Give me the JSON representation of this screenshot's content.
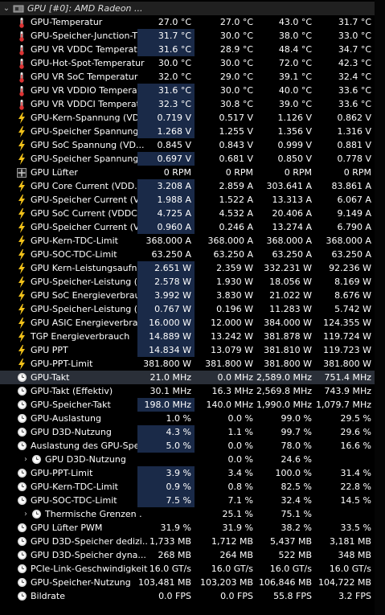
{
  "header": {
    "title": "GPU [#0]: AMD Radeon ..."
  },
  "rows": [
    {
      "icon": "thermometer-icon",
      "name": "GPU-Temperatur",
      "v": [
        "27.0 °C",
        "27.0 °C",
        "43.0 °C",
        "31.7 °C"
      ],
      "hl": false
    },
    {
      "icon": "thermometer-icon",
      "name": "GPU-Speicher-Junction-T...",
      "v": [
        "31.7 °C",
        "30.0 °C",
        "38.0 °C",
        "33.0 °C"
      ],
      "hl": true
    },
    {
      "icon": "thermometer-icon",
      "name": "GPU VR VDDC Temperatur",
      "v": [
        "31.6 °C",
        "28.9 °C",
        "48.4 °C",
        "34.7 °C"
      ],
      "hl": true
    },
    {
      "icon": "thermometer-icon",
      "name": "GPU-Hot-Spot-Temperatur",
      "v": [
        "30.0 °C",
        "30.0 °C",
        "72.0 °C",
        "42.3 °C"
      ],
      "hl": false
    },
    {
      "icon": "thermometer-icon",
      "name": "GPU VR SoC Temperatur",
      "v": [
        "32.0 °C",
        "29.0 °C",
        "39.1 °C",
        "32.4 °C"
      ],
      "hl": false
    },
    {
      "icon": "thermometer-icon",
      "name": "GPU VR VDDIO Temperatur",
      "v": [
        "31.6 °C",
        "30.0 °C",
        "40.0 °C",
        "33.6 °C"
      ],
      "hl": true
    },
    {
      "icon": "thermometer-icon",
      "name": "GPU VR VDDCI Temperatur",
      "v": [
        "32.3 °C",
        "30.8 °C",
        "39.0 °C",
        "33.6 °C"
      ],
      "hl": true
    },
    {
      "icon": "lightning-icon",
      "name": "GPU-Kern-Spannung (VD...",
      "v": [
        "0.719 V",
        "0.517 V",
        "1.126 V",
        "0.862 V"
      ],
      "hl": true
    },
    {
      "icon": "lightning-icon",
      "name": "GPU-Speicher Spannung ...",
      "v": [
        "1.268 V",
        "1.255 V",
        "1.356 V",
        "1.316 V"
      ],
      "hl": true
    },
    {
      "icon": "lightning-icon",
      "name": "GPU SoC Spannung (VD...",
      "v": [
        "0.845 V",
        "0.843 V",
        "0.999 V",
        "0.881 V"
      ],
      "hl": false
    },
    {
      "icon": "lightning-icon",
      "name": "GPU-Speicher Spannung ...",
      "v": [
        "0.697 V",
        "0.681 V",
        "0.850 V",
        "0.778 V"
      ],
      "hl": true
    },
    {
      "icon": "fan-icon",
      "name": "GPU Lüfter",
      "v": [
        "0 RPM",
        "0 RPM",
        "0 RPM",
        "0 RPM"
      ],
      "hl": false
    },
    {
      "icon": "lightning-icon",
      "name": "GPU Core Current (VDD...",
      "v": [
        "3.208 A",
        "2.859 A",
        "303.641 A",
        "83.861 A"
      ],
      "hl": true
    },
    {
      "icon": "lightning-icon",
      "name": "GPU-Speicher Current (V...",
      "v": [
        "1.988 A",
        "1.522 A",
        "13.313 A",
        "6.067 A"
      ],
      "hl": true
    },
    {
      "icon": "lightning-icon",
      "name": "GPU SoC Current (VDDC...",
      "v": [
        "4.725 A",
        "4.532 A",
        "20.406 A",
        "9.149 A"
      ],
      "hl": true
    },
    {
      "icon": "lightning-icon",
      "name": "GPU-Speicher Current (V...",
      "v": [
        "0.960 A",
        "0.246 A",
        "13.274 A",
        "6.790 A"
      ],
      "hl": true
    },
    {
      "icon": "lightning-icon",
      "name": "GPU-Kern-TDC-Limit",
      "v": [
        "368.000 A",
        "368.000 A",
        "368.000 A",
        "368.000 A"
      ],
      "hl": false
    },
    {
      "icon": "lightning-icon",
      "name": "GPU-SOC-TDC-Limit",
      "v": [
        "63.250 A",
        "63.250 A",
        "63.250 A",
        "63.250 A"
      ],
      "hl": false
    },
    {
      "icon": "lightning-icon",
      "name": "GPU Kern-Leistungsaufn...",
      "v": [
        "2.651 W",
        "2.359 W",
        "332.231 W",
        "92.236 W"
      ],
      "hl": true
    },
    {
      "icon": "lightning-icon",
      "name": "GPU-Speicher-Leistung (...",
      "v": [
        "2.578 W",
        "1.930 W",
        "18.056 W",
        "8.169 W"
      ],
      "hl": true
    },
    {
      "icon": "lightning-icon",
      "name": "GPU SoC Energieverbrau...",
      "v": [
        "3.992 W",
        "3.830 W",
        "21.022 W",
        "8.676 W"
      ],
      "hl": true
    },
    {
      "icon": "lightning-icon",
      "name": "GPU-Speicher-Leistung (...",
      "v": [
        "0.767 W",
        "0.196 W",
        "11.283 W",
        "5.742 W"
      ],
      "hl": true
    },
    {
      "icon": "lightning-icon",
      "name": "GPU ASIC Energieverbra...",
      "v": [
        "16.000 W",
        "12.000 W",
        "384.000 W",
        "124.355 W"
      ],
      "hl": true
    },
    {
      "icon": "lightning-icon",
      "name": "TGP Energieverbrauch",
      "v": [
        "14.889 W",
        "13.242 W",
        "381.878 W",
        "119.724 W"
      ],
      "hl": true
    },
    {
      "icon": "lightning-icon",
      "name": "GPU PPT",
      "v": [
        "14.834 W",
        "13.079 W",
        "381.810 W",
        "119.723 W"
      ],
      "hl": true
    },
    {
      "icon": "lightning-icon",
      "name": "GPU-PPT-Limit",
      "v": [
        "381.800 W",
        "381.800 W",
        "381.800 W",
        "381.800 W"
      ],
      "hl": false
    },
    {
      "icon": "clock-icon",
      "name": "GPU-Takt",
      "v": [
        "21.0 MHz",
        "0.0 MHz",
        "2,589.0 MHz",
        "751.4 MHz"
      ],
      "hl": false,
      "sel": true
    },
    {
      "icon": "clock-icon",
      "name": "GPU-Takt (Effektiv)",
      "v": [
        "30.1 MHz",
        "16.3 MHz",
        "2,569.8 MHz",
        "743.9 MHz"
      ],
      "hl": false
    },
    {
      "icon": "clock-icon",
      "name": "GPU-Speicher-Takt",
      "v": [
        "198.0 MHz",
        "140.0 MHz",
        "1,990.0 MHz",
        "1,079.7 MHz"
      ],
      "hl": true
    },
    {
      "icon": "clock-icon",
      "name": "GPU-Auslastung",
      "v": [
        "1.0 %",
        "0.0 %",
        "99.0 %",
        "29.5 %"
      ],
      "hl": false
    },
    {
      "icon": "clock-icon",
      "name": "GPU D3D-Nutzung",
      "v": [
        "4.3 %",
        "1.1 %",
        "99.7 %",
        "29.6 %"
      ],
      "hl": true
    },
    {
      "icon": "clock-icon",
      "name": "Auslastung des GPU-Spe...",
      "v": [
        "5.0 %",
        "0.0 %",
        "78.0 %",
        "16.6 %"
      ],
      "hl": true
    },
    {
      "icon": "clock-icon",
      "name": "GPU D3D-Nutzung",
      "v": [
        "",
        "0.0 %",
        "24.6 %",
        ""
      ],
      "hl": false,
      "expand": true
    },
    {
      "icon": "clock-icon",
      "name": "GPU-PPT-Limit",
      "v": [
        "3.9 %",
        "3.4 %",
        "100.0 %",
        "31.4 %"
      ],
      "hl": true
    },
    {
      "icon": "clock-icon",
      "name": "GPU-Kern-TDC-Limit",
      "v": [
        "0.9 %",
        "0.8 %",
        "82.5 %",
        "22.8 %"
      ],
      "hl": true
    },
    {
      "icon": "clock-icon",
      "name": "GPU-SOC-TDC-Limit",
      "v": [
        "7.5 %",
        "7.1 %",
        "32.4 %",
        "14.5 %"
      ],
      "hl": true
    },
    {
      "icon": "clock-icon",
      "name": "Thermische Grenzen ...",
      "v": [
        "",
        "25.1 %",
        "75.1 %",
        ""
      ],
      "hl": false,
      "expand": true
    },
    {
      "icon": "clock-icon",
      "name": "GPU Lüfter PWM",
      "v": [
        "31.9 %",
        "31.9 %",
        "38.2 %",
        "33.5 %"
      ],
      "hl": false
    },
    {
      "icon": "clock-icon",
      "name": "GPU D3D-Speicher dedizi...",
      "v": [
        "1,733 MB",
        "1,712 MB",
        "5,437 MB",
        "3,181 MB"
      ],
      "hl": false
    },
    {
      "icon": "clock-icon",
      "name": "GPU D3D-Speicher dyna...",
      "v": [
        "268 MB",
        "264 MB",
        "522 MB",
        "348 MB"
      ],
      "hl": false
    },
    {
      "icon": "clock-icon",
      "name": "PCIe-Link-Geschwindigkeit",
      "v": [
        "16.0 GT/s",
        "16.0 GT/s",
        "16.0 GT/s",
        "16.0 GT/s"
      ],
      "hl": false
    },
    {
      "icon": "clock-icon",
      "name": "GPU-Speicher-Nutzung",
      "v": [
        "103,481 MB",
        "103,203 MB",
        "106,846 MB",
        "104,722 MB"
      ],
      "hl": false
    },
    {
      "icon": "clock-icon",
      "name": "Bildrate",
      "v": [
        "0.0 FPS",
        "0.0 FPS",
        "55.8 FPS",
        "3.2 FPS"
      ],
      "hl": false
    }
  ]
}
